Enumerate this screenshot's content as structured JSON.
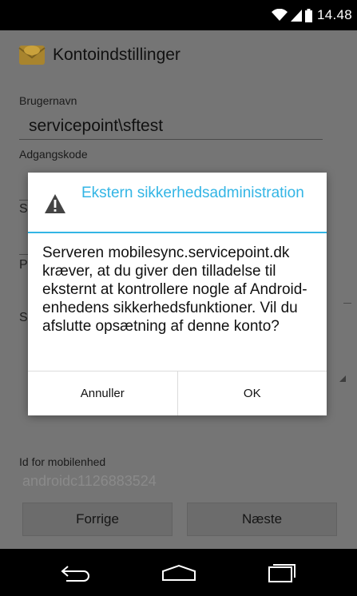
{
  "status_bar": {
    "time": "14.48",
    "icons": [
      "wifi-icon",
      "signal-icon",
      "battery-icon"
    ]
  },
  "action_bar": {
    "title": "Kontoindstillinger",
    "icon": "email-app-icon"
  },
  "form": {
    "username_label": "Brugernavn",
    "username_value": "servicepoint\\sftest",
    "password_label": "Adgangskode",
    "hidden_label_1": "S",
    "hidden_label_2": "P",
    "hidden_label_3": "S",
    "device_id_label": "Id for mobilenhed",
    "device_id_value": "androidc1126883524"
  },
  "buttons": {
    "previous": "Forrige",
    "next": "Næste"
  },
  "dialog": {
    "title": "Ekstern sikkerhedsadministration",
    "message": "Serveren mobilesync.servicepoint.dk kræver, at du giver den tilladelse til eksternt at kontrollere nogle af Android-enhedens sikkerhedsfunktioner. Vil du afslutte opsætning af denne konto?",
    "cancel": "Annuller",
    "ok": "OK",
    "icon": "warning-icon"
  },
  "colors": {
    "accent": "#33b5e5",
    "dim_background": "#757575",
    "bars": "#000000"
  }
}
